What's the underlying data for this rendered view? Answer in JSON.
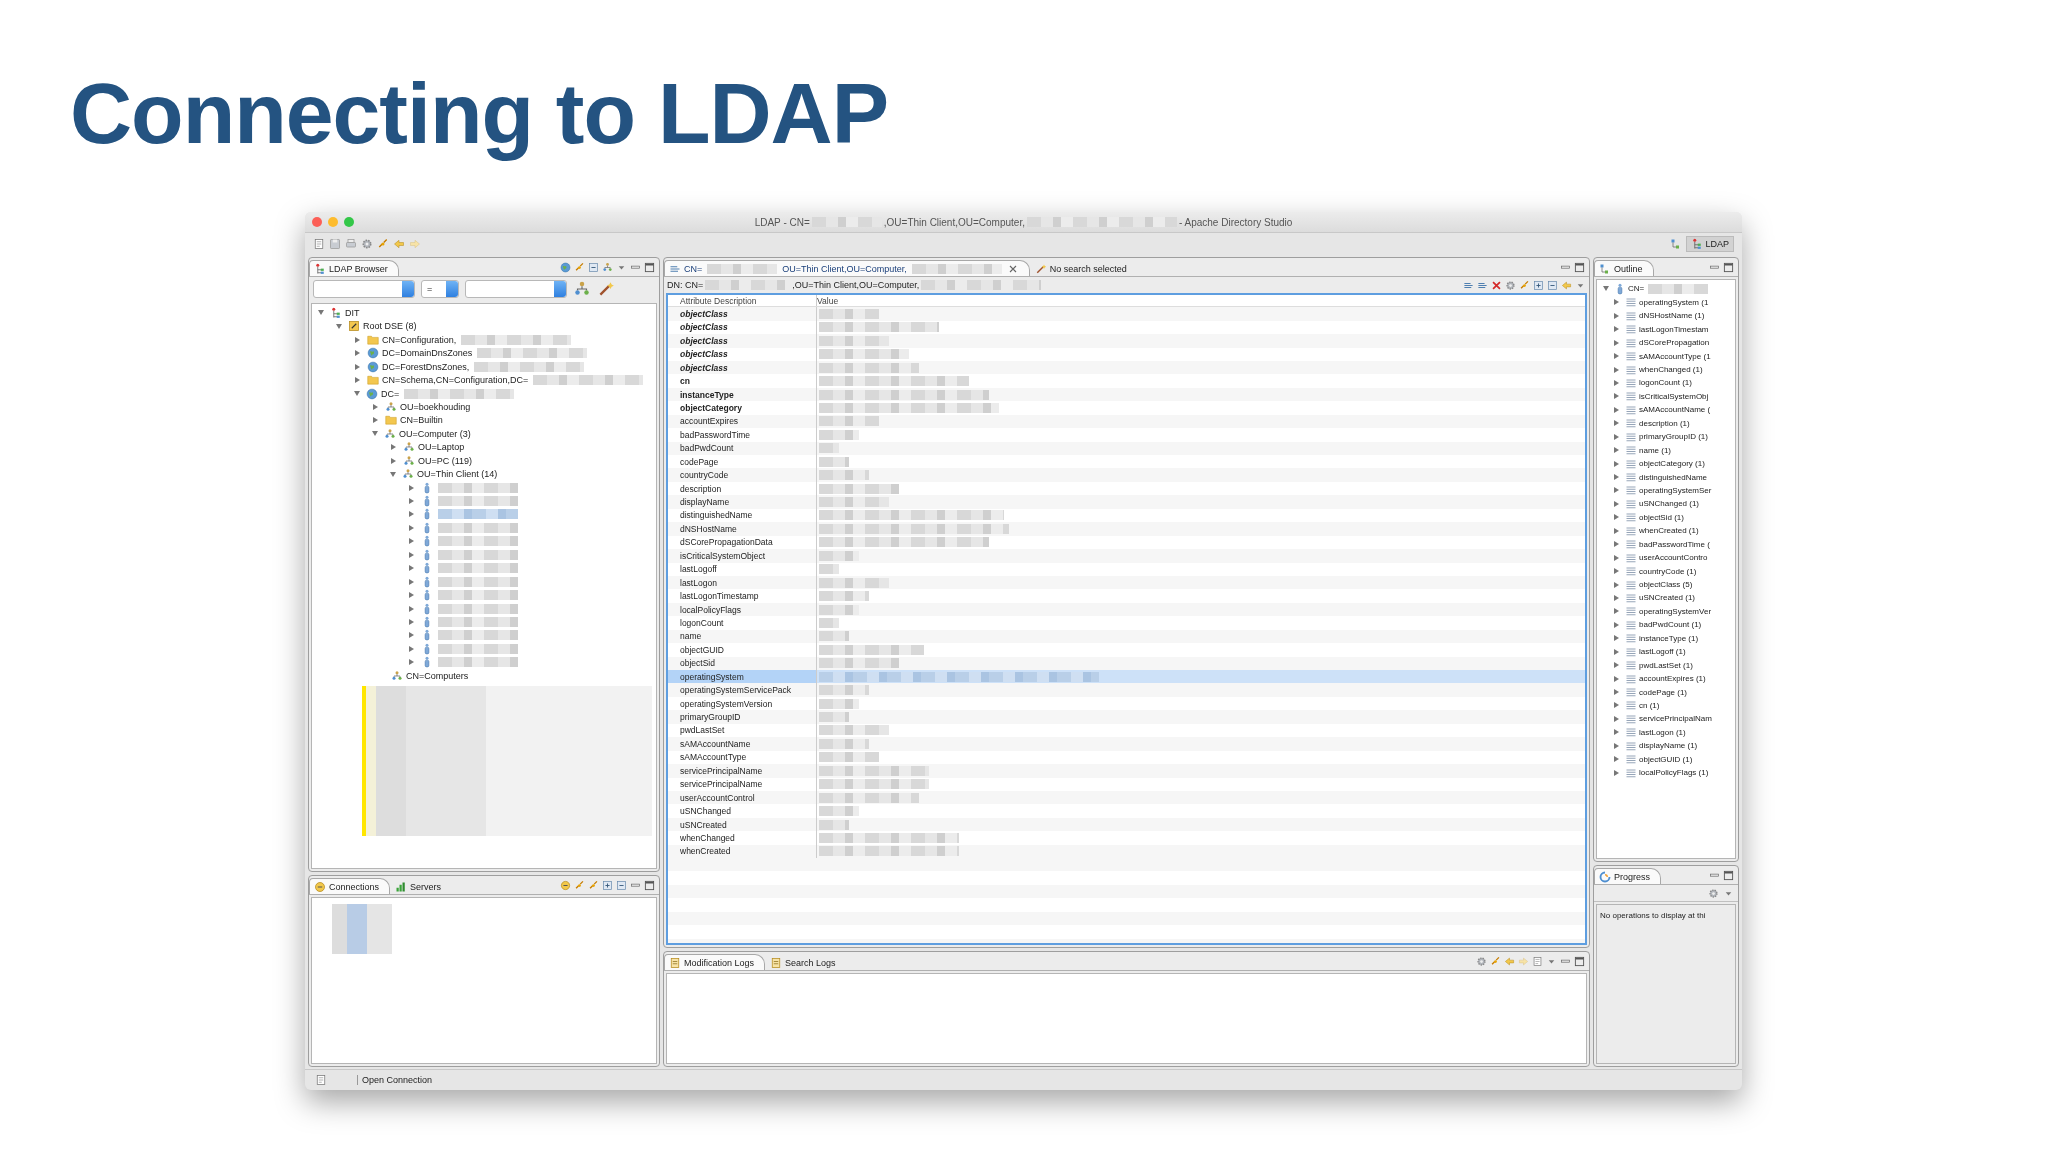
{
  "slide_title": "Connecting to LDAP",
  "window": {
    "title": [
      {
        "kind": "text",
        "text": "LDAP - CN="
      },
      {
        "kind": "redacted"
      },
      {
        "kind": "text",
        "text": ",OU=Thin Client,OU=Computer,"
      },
      {
        "kind": "redacted"
      },
      {
        "kind": "text",
        "text": "- Apache Directory Studio"
      }
    ],
    "perspective": {
      "label": "LDAP",
      "selected": true
    }
  },
  "ldap_browser": {
    "tab": "LDAP Browser",
    "filter_operator": "=",
    "tree": [
      {
        "kind": "dit",
        "label": "DIT",
        "expanded": true,
        "selected": false,
        "children": [
          {
            "kind": "root",
            "label": "Root DSE (8)",
            "expanded": true,
            "selected": false,
            "children": [
              {
                "kind": "folder",
                "label": "CN=Configuration,",
                "redacted": true,
                "expanded": false,
                "selected": false
              },
              {
                "kind": "globe",
                "label": "DC=DomainDnsZones",
                "redacted": true,
                "expanded": false,
                "selected": false
              },
              {
                "kind": "globe",
                "label": "DC=ForestDnsZones,",
                "redacted": true,
                "expanded": false,
                "selected": false
              },
              {
                "kind": "folder",
                "label": "CN=Schema,CN=Configuration,DC=",
                "redacted": true,
                "expanded": false,
                "selected": false
              },
              {
                "kind": "globe",
                "label": "DC=",
                "redacted": true,
                "expanded": true,
                "selected": false,
                "children": [
                  {
                    "kind": "ou",
                    "label": "OU=boekhouding",
                    "expanded": false,
                    "selected": false
                  },
                  {
                    "kind": "folder",
                    "label": "CN=Builtin",
                    "expanded": false,
                    "selected": false
                  },
                  {
                    "kind": "ou",
                    "label": "OU=Computer (3)",
                    "expanded": true,
                    "selected": false,
                    "children": [
                      {
                        "kind": "ou",
                        "label": "OU=Laptop",
                        "expanded": false,
                        "selected": false
                      },
                      {
                        "kind": "ou",
                        "label": "OU=PC (119)",
                        "expanded": false,
                        "selected": false
                      },
                      {
                        "kind": "ou",
                        "label": "OU=Thin Client (14)",
                        "expanded": true,
                        "selected": false,
                        "children": [
                          {
                            "kind": "computer",
                            "redacted": true,
                            "expanded": false,
                            "selected": false
                          },
                          {
                            "kind": "computer",
                            "redacted": true,
                            "expanded": false,
                            "selected": false
                          },
                          {
                            "kind": "computer",
                            "redacted": true,
                            "expanded": false,
                            "selected": true
                          },
                          {
                            "kind": "computer",
                            "redacted": true,
                            "expanded": false,
                            "selected": false
                          },
                          {
                            "kind": "computer",
                            "redacted": true,
                            "expanded": false,
                            "selected": false
                          },
                          {
                            "kind": "computer",
                            "redacted": true,
                            "expanded": false,
                            "selected": false
                          },
                          {
                            "kind": "computer",
                            "redacted": true,
                            "expanded": false,
                            "selected": false
                          },
                          {
                            "kind": "computer",
                            "redacted": true,
                            "expanded": false,
                            "selected": false
                          },
                          {
                            "kind": "computer",
                            "redacted": true,
                            "expanded": false,
                            "selected": false
                          },
                          {
                            "kind": "computer",
                            "redacted": true,
                            "expanded": false,
                            "selected": false
                          },
                          {
                            "kind": "computer",
                            "redacted": true,
                            "expanded": false,
                            "selected": false
                          },
                          {
                            "kind": "computer",
                            "redacted": true,
                            "expanded": false,
                            "selected": false
                          },
                          {
                            "kind": "computer",
                            "redacted": true,
                            "expanded": false,
                            "selected": false
                          },
                          {
                            "kind": "computer",
                            "redacted": true,
                            "expanded": false,
                            "selected": false
                          }
                        ]
                      }
                    ]
                  },
                  {
                    "kind": "ou",
                    "label": "CN=Computers",
                    "selected": false
                  }
                ]
              }
            ]
          }
        ]
      }
    ],
    "redacted_area": true
  },
  "connections": {
    "tabs": [
      {
        "label": "Connections",
        "selected": true
      },
      {
        "label": "Servers",
        "selected": false
      }
    ],
    "redacted_list": true
  },
  "status_bar": {
    "message": "Open Connection"
  },
  "editor": {
    "tabs": [
      {
        "kind": "entry",
        "label": [
          {
            "kind": "text",
            "text": "CN="
          },
          {
            "kind": "redacted"
          },
          {
            "kind": "text",
            "text": "OU=Thin Client,OU=Computer,"
          },
          {
            "kind": "redacted"
          }
        ],
        "selected": true
      },
      {
        "kind": "search",
        "label": [
          {
            "kind": "text",
            "text": "No search selected"
          }
        ],
        "selected": false
      }
    ],
    "dn": [
      {
        "kind": "text",
        "text": "DN: CN="
      },
      {
        "kind": "redacted"
      },
      {
        "kind": "text",
        "text": ",OU=Thin Client,OU=Computer,"
      },
      {
        "kind": "redacted"
      }
    ],
    "columns": [
      "Attribute Description",
      "Value"
    ],
    "rows": [
      {
        "attribute": "objectClass",
        "kind": "objectclass",
        "selected": false
      },
      {
        "attribute": "objectClass",
        "kind": "objectclass",
        "selected": false
      },
      {
        "attribute": "objectClass",
        "kind": "objectclass",
        "selected": false
      },
      {
        "attribute": "objectClass",
        "kind": "objectclass",
        "selected": false
      },
      {
        "attribute": "objectClass",
        "kind": "objectclass",
        "selected": false
      },
      {
        "attribute": "cn",
        "kind": "must",
        "selected": false
      },
      {
        "attribute": "instanceType",
        "kind": "must",
        "selected": false
      },
      {
        "attribute": "objectCategory",
        "kind": "must",
        "selected": false
      },
      {
        "attribute": "accountExpires",
        "kind": "may",
        "selected": false
      },
      {
        "attribute": "badPasswordTime",
        "kind": "may",
        "selected": false
      },
      {
        "attribute": "badPwdCount",
        "kind": "may",
        "selected": false
      },
      {
        "attribute": "codePage",
        "kind": "may",
        "selected": false
      },
      {
        "attribute": "countryCode",
        "kind": "may",
        "selected": false
      },
      {
        "attribute": "description",
        "kind": "may",
        "selected": false
      },
      {
        "attribute": "displayName",
        "kind": "may",
        "selected": false
      },
      {
        "attribute": "distinguishedName",
        "kind": "may",
        "selected": false
      },
      {
        "attribute": "dNSHostName",
        "kind": "may",
        "selected": false
      },
      {
        "attribute": "dSCorePropagationData",
        "kind": "may",
        "selected": false
      },
      {
        "attribute": "isCriticalSystemObject",
        "kind": "may",
        "selected": false
      },
      {
        "attribute": "lastLogoff",
        "kind": "may",
        "selected": false
      },
      {
        "attribute": "lastLogon",
        "kind": "may",
        "selected": false
      },
      {
        "attribute": "lastLogonTimestamp",
        "kind": "may",
        "selected": false
      },
      {
        "attribute": "localPolicyFlags",
        "kind": "may",
        "selected": false
      },
      {
        "attribute": "logonCount",
        "kind": "may",
        "selected": false
      },
      {
        "attribute": "name",
        "kind": "may",
        "selected": false
      },
      {
        "attribute": "objectGUID",
        "kind": "may",
        "selected": false
      },
      {
        "attribute": "objectSid",
        "kind": "may",
        "selected": false
      },
      {
        "attribute": "operatingSystem",
        "kind": "may",
        "selected": true
      },
      {
        "attribute": "operatingSystemServicePack",
        "kind": "may",
        "selected": false
      },
      {
        "attribute": "operatingSystemVersion",
        "kind": "may",
        "selected": false
      },
      {
        "attribute": "primaryGroupID",
        "kind": "may",
        "selected": false
      },
      {
        "attribute": "pwdLastSet",
        "kind": "may",
        "selected": false
      },
      {
        "attribute": "sAMAccountName",
        "kind": "may",
        "selected": false
      },
      {
        "attribute": "sAMAccountType",
        "kind": "may",
        "selected": false
      },
      {
        "attribute": "servicePrincipalName",
        "kind": "may",
        "selected": false
      },
      {
        "attribute": "servicePrincipalName",
        "kind": "may",
        "selected": false
      },
      {
        "attribute": "userAccountControl",
        "kind": "may",
        "selected": false
      },
      {
        "attribute": "uSNChanged",
        "kind": "may",
        "selected": false
      },
      {
        "attribute": "uSNCreated",
        "kind": "may",
        "selected": false
      },
      {
        "attribute": "whenChanged",
        "kind": "may",
        "selected": false
      },
      {
        "attribute": "whenCreated",
        "kind": "may",
        "selected": false
      }
    ]
  },
  "logs": {
    "tabs": [
      {
        "label": "Modification Logs",
        "selected": true
      },
      {
        "label": "Search Logs",
        "selected": false
      }
    ]
  },
  "outline": {
    "tab": "Outline",
    "root": "CN=",
    "items": [
      "operatingSystem (1",
      "dNSHostName (1)",
      "lastLogonTimestam",
      "dSCorePropagation",
      "sAMAccountType (1",
      "whenChanged (1)",
      "logonCount (1)",
      "isCriticalSystemObj",
      "sAMAccountName (",
      "description (1)",
      "primaryGroupID (1)",
      "name (1)",
      "objectCategory (1)",
      "distinguishedName",
      "operatingSystemSer",
      "uSNChanged (1)",
      "objectSid (1)",
      "whenCreated (1)",
      "badPasswordTime (",
      "userAccountContro",
      "countryCode (1)",
      "objectClass (5)",
      "uSNCreated (1)",
      "operatingSystemVer",
      "badPwdCount (1)",
      "instanceType (1)",
      "lastLogoff (1)",
      "pwdLastSet (1)",
      "accountExpires (1)",
      "codePage (1)",
      "cn (1)",
      "servicePrincipalNam",
      "lastLogon (1)",
      "displayName (1)",
      "objectGUID (1)",
      "localPolicyFlags (1)"
    ]
  },
  "progress": {
    "tab": "Progress",
    "message": "No operations to display at thi"
  }
}
